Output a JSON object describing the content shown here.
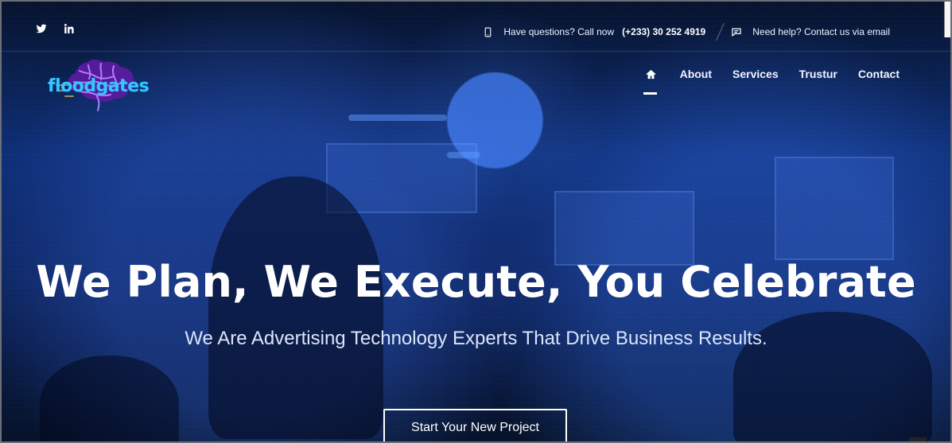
{
  "header": {
    "phone_text": "Have questions? Call now",
    "phone_number": "(+233) 30 252 4919",
    "help_text": "Need help? Contact us via email"
  },
  "branding": {
    "logo_text": "floodgates",
    "colors": {
      "accent": "#34c8ff",
      "logo_purple": "#8a3dd8",
      "overlay_blue": "#0e2f78"
    }
  },
  "navigation": {
    "items": [
      {
        "icon": "home-icon"
      },
      {
        "label": "About"
      },
      {
        "label": "Services"
      },
      {
        "label": "Trustur"
      },
      {
        "label": "Contact"
      }
    ]
  },
  "icons": {
    "social": [
      "twitter-icon",
      "linkedin-icon"
    ],
    "topbar": [
      "phone-icon",
      "chat-icon"
    ]
  },
  "hero": {
    "title": "We Plan, We Execute, You Celebrate",
    "subtitle": "We Are Advertising Technology Experts That Drive Business Results.",
    "cta": "Start Your New Project"
  }
}
